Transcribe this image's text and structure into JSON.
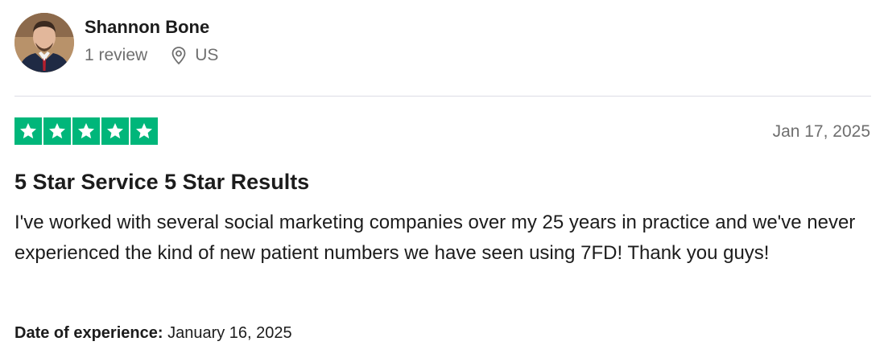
{
  "reviewer": {
    "name": "Shannon Bone",
    "review_count": "1 review",
    "location": "US",
    "avatar_icon": "reviewer-photo",
    "location_icon": "location-pin-icon"
  },
  "review": {
    "rating": 5,
    "rating_max": 5,
    "star_color": "#00b67a",
    "date": "Jan 17, 2025",
    "title": "5 Star Service 5 Star Results",
    "body": "I've worked with several social marketing companies over my 25 years in practice and we've never experienced the kind of new patient numbers we have seen using 7FD! Thank you guys!",
    "experience_label": "Date of experience:",
    "experience_date": "January 16, 2025"
  }
}
